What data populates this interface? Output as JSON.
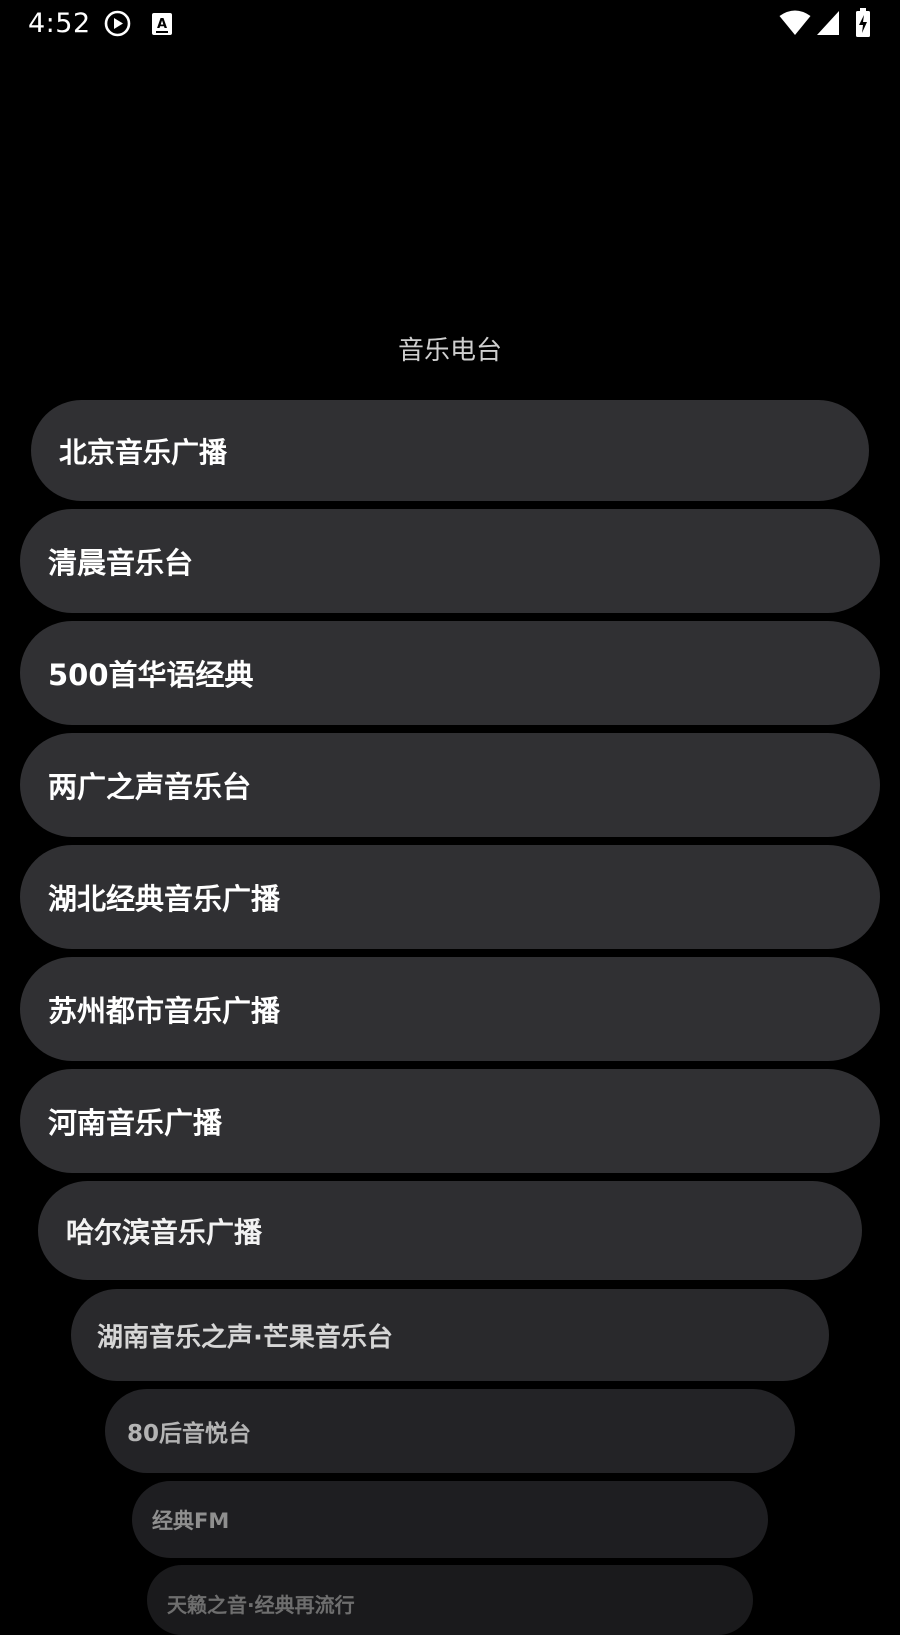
{
  "status": {
    "time": "4:52",
    "icons": [
      "play-circle-icon",
      "keyboard-a-icon",
      "wifi-icon",
      "signal-icon",
      "battery-charging-icon"
    ]
  },
  "header": {
    "title": "音乐电台"
  },
  "stations": [
    "北京音乐广播",
    "清晨音乐台",
    "500首华语经典",
    "两广之声音乐台",
    "湖北经典音乐广播",
    "苏州都市音乐广播",
    "河南音乐广播",
    "哈尔滨音乐广播",
    "湖南音乐之声·芒果音乐台",
    "80后音悦台",
    "经典FM",
    "天籁之音·经典再流行"
  ]
}
